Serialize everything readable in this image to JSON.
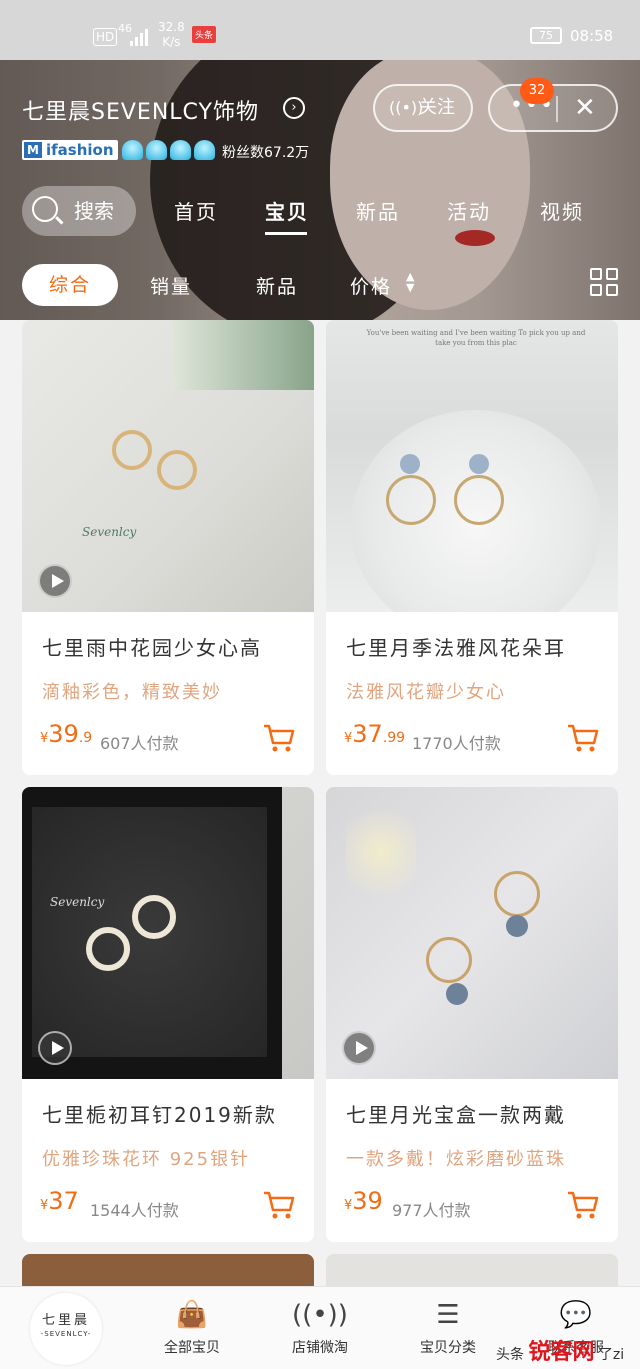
{
  "status_bar": {
    "hd": "HD",
    "network": "46",
    "speed_value": "32.8",
    "speed_unit": "K/s",
    "news_app": "头条",
    "battery": "75",
    "time": "08:58"
  },
  "shop": {
    "name": "七里晨SEVENLCY饰物",
    "badge": "ifashion",
    "fans": "粉丝数67.2万",
    "follow_label": "关注",
    "more_badge": "32"
  },
  "nav": {
    "search_label": "搜索",
    "tabs": [
      "首页",
      "宝贝",
      "新品",
      "活动",
      "视频"
    ],
    "active_tab": "宝贝"
  },
  "sort": {
    "options": [
      "综合",
      "销量",
      "新品",
      "价格"
    ],
    "active": "综合"
  },
  "products": [
    {
      "title": "七里雨中花园少女心高",
      "subtitle": "滴釉彩色，精致美妙",
      "price_int": "39",
      "price_dec": ".9",
      "sales": "607人付款",
      "image_text": "Sevenlcy",
      "has_video": true
    },
    {
      "title": "七里月季法雅风花朵耳",
      "subtitle": "法雅风花瓣少女心",
      "price_int": "37",
      "price_dec": ".99",
      "sales": "1770人付款",
      "image_text": "You've been waiting and I've been waiting To pick you up and take you from this plac",
      "has_video": false
    },
    {
      "title": "七里栀初耳钉2019新款",
      "subtitle": "优雅珍珠花环 925银针",
      "price_int": "37",
      "price_dec": "",
      "sales": "1544人付款",
      "image_text": "Sevenlcy",
      "has_video": true
    },
    {
      "title": "七里月光宝盒一款两戴",
      "subtitle": "一款多戴！炫彩磨砂蓝珠",
      "price_int": "39",
      "price_dec": "",
      "sales": "977人付款",
      "image_text": "",
      "has_video": true
    }
  ],
  "currency": "¥",
  "bottom_nav": {
    "logo_line1": "七里晨",
    "logo_line2": "-SEVENLCY-",
    "items": [
      "全部宝贝",
      "店铺微淘",
      "宝贝分类",
      "联系客服"
    ]
  },
  "watermark": {
    "prefix": "头条",
    "brand": "锐客网",
    "suffix": "了zi"
  },
  "colors": {
    "accent": "#f46b12",
    "subtitle": "#e0a57f",
    "ifashion": "#2a6fb5",
    "badge": "#ff5a16"
  }
}
